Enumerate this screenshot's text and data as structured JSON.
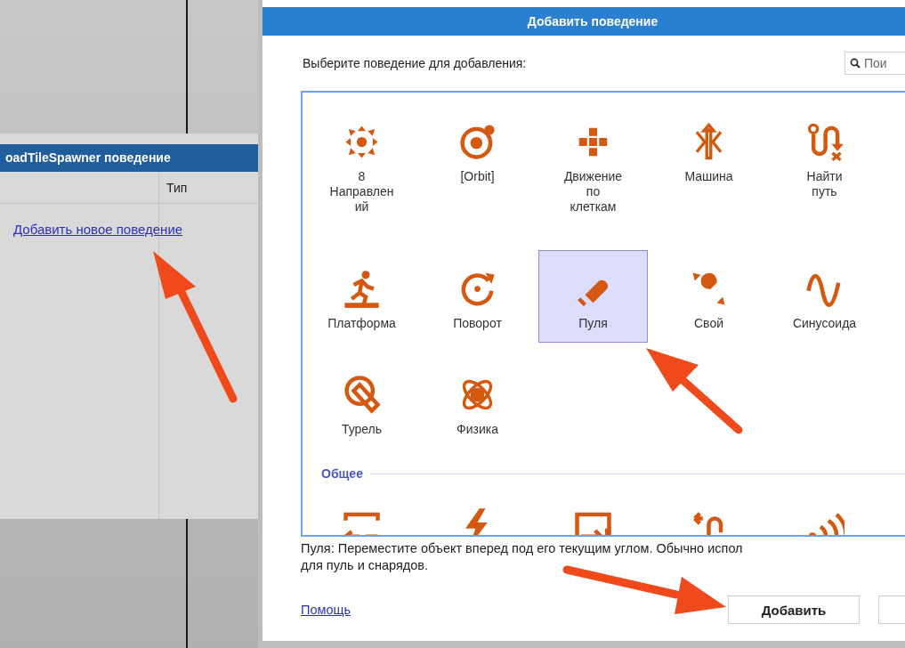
{
  "behaviors_panel": {
    "title": "oadTileSpawner поведение",
    "columns": [
      "Тип"
    ],
    "add_link": "Добавить новое поведение"
  },
  "dialog": {
    "title": "Добавить поведение",
    "prompt": "Выберите поведение для добавления:",
    "search": {
      "placeholder": "Пои"
    },
    "sections": [
      {
        "items": [
          {
            "label": "8 Направлен ий",
            "selected": false
          },
          {
            "label": "[Orbit]",
            "selected": false
          },
          {
            "label": "Движение по клеткам",
            "selected": false
          },
          {
            "label": "Машина",
            "selected": false
          },
          {
            "label": "Найти путь",
            "selected": false
          },
          {
            "label": "Платформа",
            "selected": false
          },
          {
            "label": "Поворот",
            "selected": false
          },
          {
            "label": "Пуля",
            "selected": true
          },
          {
            "label": "Свой",
            "selected": false
          },
          {
            "label": "Синусоида",
            "selected": false
          },
          {
            "label": "Турель",
            "selected": false
          },
          {
            "label": "Физика",
            "selected": false
          }
        ]
      },
      {
        "title": "Общее",
        "items": [
          {
            "selected": false
          },
          {
            "selected": false
          },
          {
            "selected": false
          },
          {
            "selected": false
          },
          {
            "selected": false
          }
        ]
      }
    ],
    "description": [
      "Пуля: Переместите объект вперед под его текущим углом. Обычно испол",
      "для пуль и снарядов."
    ],
    "help_link": "Помощь",
    "buttons": [
      {
        "label": "Добавить",
        "kind": "default"
      },
      {
        "kind": "secondary"
      }
    ]
  }
}
